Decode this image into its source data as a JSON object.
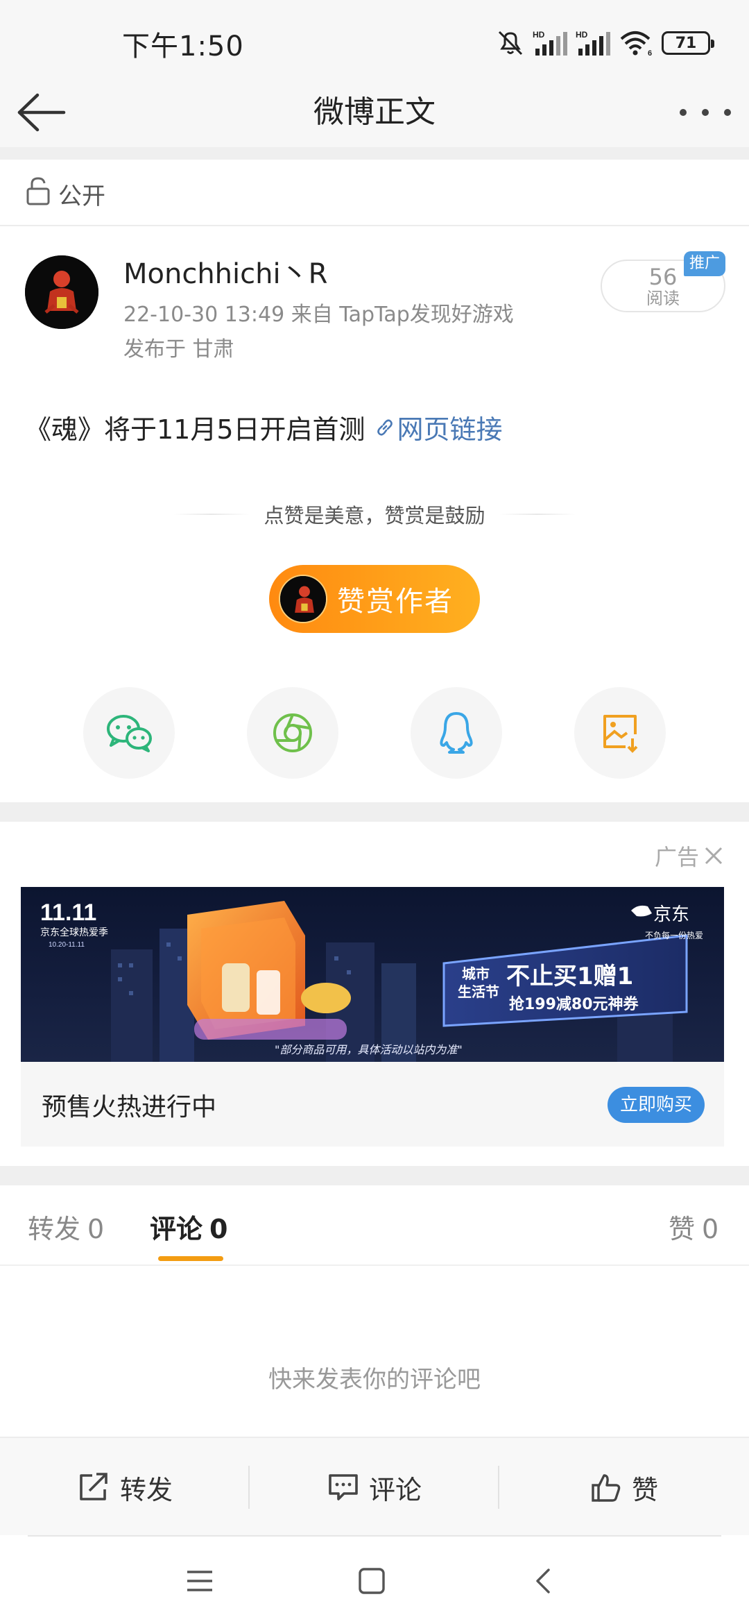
{
  "status": {
    "time": "下午1:50",
    "battery": "71",
    "network1": "HD",
    "network2": "HD",
    "wifi_suffix": "6"
  },
  "header": {
    "title": "微博正文"
  },
  "visibility": {
    "label": "公开"
  },
  "post": {
    "author": "Monchhichi丶R",
    "meta": "22-10-30 13:49   来自 TapTap发现好游戏",
    "location": "发布于 甘肃",
    "read_count": "56",
    "read_label": "阅读",
    "promo_tag": "推广",
    "content": "《魂》将于11月5日开启首测",
    "link_label": "网页链接"
  },
  "reward": {
    "slogan": "点赞是美意，赞赏是鼓励",
    "button": "赞赏作者"
  },
  "share": {
    "items": [
      "wechat-icon",
      "moments-icon",
      "qq-icon",
      "save-image-icon"
    ]
  },
  "ad": {
    "label": "广告",
    "banner": {
      "logo": "11.11",
      "logo_sub": "京东全球热爱季",
      "logo_date": "10.20-11.11",
      "brand": "京东",
      "brand_slogan": "不负每一份热爱",
      "line1": "城市",
      "line2": "生活节",
      "headline": "不止买1赠1",
      "subline": "抢199减80元神券",
      "disclaimer": "\"部分商品可用，具体活动以站内为准\""
    },
    "title": "预售火热进行中",
    "buy_button": "立即购买"
  },
  "tabs": {
    "repost_label": "转发",
    "repost_count": "0",
    "comment_label": "评论",
    "comment_count": "0",
    "like_label": "赞",
    "like_count": "0"
  },
  "comments": {
    "empty_text": "快来发表你的评论吧"
  },
  "actions": {
    "repost": "转发",
    "comment": "评论",
    "like": "赞"
  },
  "colors": {
    "accent_orange": "#f39c12",
    "link_blue": "#4a79b5",
    "buy_blue": "#3c8ee0"
  }
}
